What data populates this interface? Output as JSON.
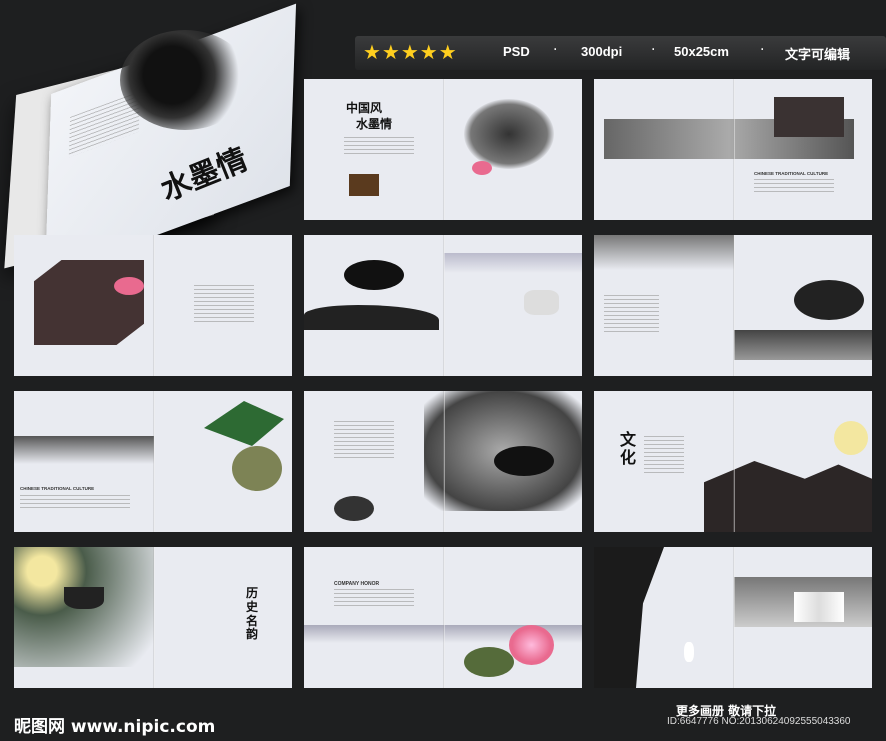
{
  "header": {
    "stars": "★★★★★",
    "format": "PSD",
    "resolution": "300dpi",
    "size": "50x25cm",
    "note": "文字可编辑",
    "separator": "·"
  },
  "cover": {
    "title": "水墨情"
  },
  "spreads": {
    "s1": {
      "title1": "中国风",
      "title2": "水墨情"
    },
    "s2": {
      "caption": "CHINESE TRADITIONAL CULTURE"
    },
    "s5": {
      "caption": "CHINESE TRADITIONAL CULTURE"
    },
    "s8": {
      "title": "文化"
    },
    "s9": {
      "title": "历史名韵"
    },
    "s10": {
      "caption": "COMPANY HONOR"
    }
  },
  "footer": {
    "logo": "昵图网 www.nipic.com",
    "more": "更多画册   敬请下拉",
    "id": "ID:6647776 NO:20130624092555043360"
  },
  "colors": {
    "background": "#1e1f20",
    "star": "#ffcf1f",
    "page": "#e9ebf1",
    "lotus": "#e96a8f"
  }
}
